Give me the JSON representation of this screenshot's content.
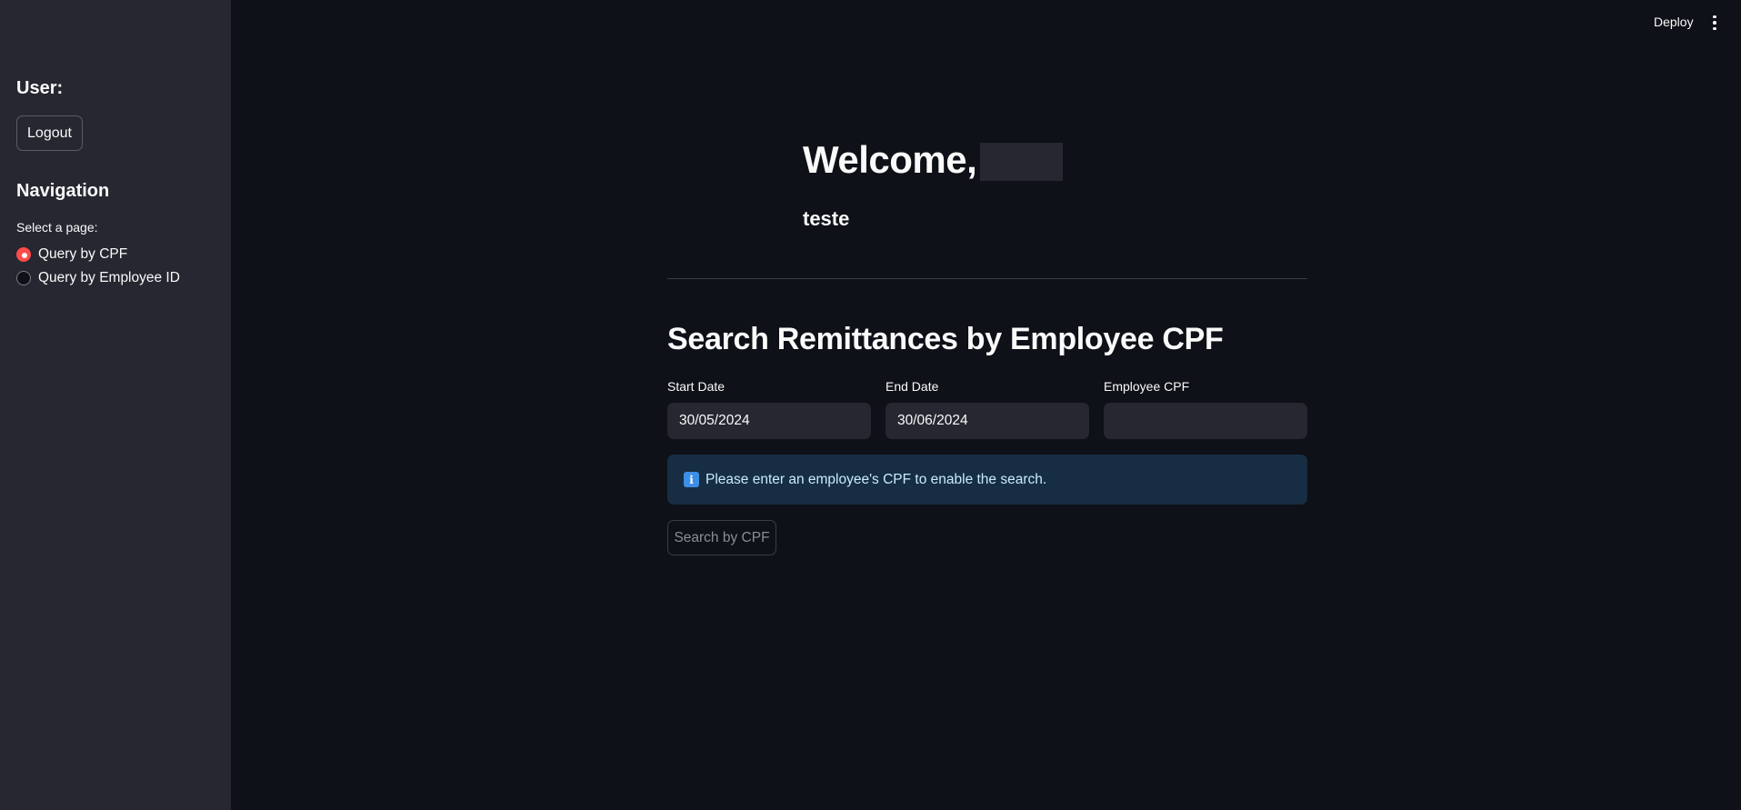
{
  "header": {
    "deploy_label": "Deploy",
    "menu_icon": "kebab-menu-icon"
  },
  "sidebar": {
    "user_heading": "User:",
    "logout_label": "Logout",
    "nav_heading": "Navigation",
    "select_label": "Select a page:",
    "options": [
      {
        "label": "Query by CPF",
        "selected": true
      },
      {
        "label": "Query by Employee ID",
        "selected": false
      }
    ]
  },
  "main": {
    "welcome": "Welcome,",
    "subtitle": "teste",
    "section_title": "Search Remittances by Employee CPF",
    "fields": [
      {
        "label": "Start Date",
        "value": "30/05/2024"
      },
      {
        "label": "End Date",
        "value": "30/06/2024"
      },
      {
        "label": "Employee CPF",
        "value": ""
      }
    ],
    "info_message": "Please enter an employee's CPF to enable the search.",
    "info_icon": "info-icon",
    "search_button": "Search by CPF",
    "search_button_disabled": true
  },
  "colors": {
    "background": "#0e1117",
    "sidebar": "#262730",
    "accent": "#ff4b4b",
    "info_bg": "#172d43",
    "info_text": "#c7ebff"
  }
}
